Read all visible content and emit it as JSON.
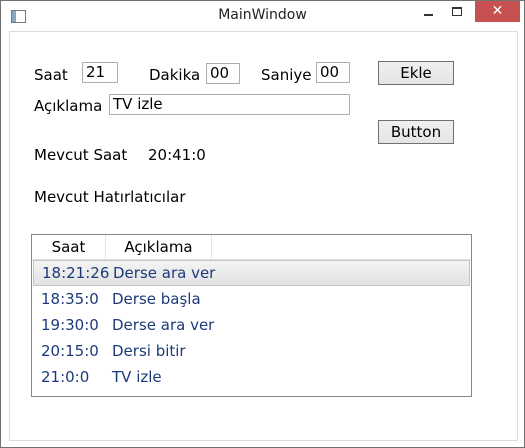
{
  "window": {
    "title": "MainWindow",
    "close_glyph": "✕"
  },
  "form": {
    "hour_label": "Saat",
    "hour_value": "21",
    "minute_label": "Dakika",
    "minute_value": "00",
    "second_label": "Saniye",
    "second_value": "00",
    "add_button": "Ekle",
    "description_label": "Açıklama",
    "description_value": "TV izle",
    "button_label": "Button",
    "current_time_label": "Mevcut Saat",
    "current_time_value": "20:41:0",
    "reminders_label": "Mevcut Hatırlatıcılar"
  },
  "list": {
    "columns": [
      "Saat",
      "Açıklama"
    ],
    "rows": [
      {
        "time": "18:21:26",
        "desc": "Derse ara ver"
      },
      {
        "time": "18:35:0",
        "desc": "Derse başla"
      },
      {
        "time": "19:30:0",
        "desc": "Derse ara ver"
      },
      {
        "time": "20:15:0",
        "desc": "Dersi bitir"
      },
      {
        "time": "21:0:0",
        "desc": "TV izle"
      }
    ],
    "selected_index": 0
  },
  "colors": {
    "close_button": "#c75050",
    "row_text": "#1c3a7a"
  }
}
